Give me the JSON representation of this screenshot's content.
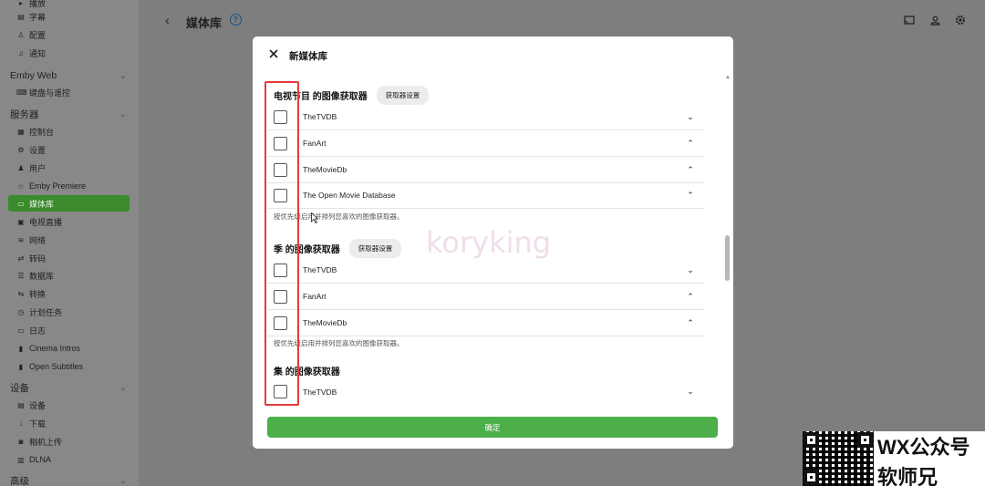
{
  "sidebar": {
    "items_top": [
      {
        "label": "播放",
        "icon": "play-icon"
      },
      {
        "label": "字幕",
        "icon": "subtitles-icon"
      },
      {
        "label": "配置",
        "icon": "profile-icon"
      },
      {
        "label": "通知",
        "icon": "bell-icon"
      }
    ],
    "emby_web_header": "Emby Web",
    "emby_web_items": [
      {
        "label": "键盘与遥控",
        "icon": "keyboard-icon"
      }
    ],
    "server_header": "服务器",
    "server_items": [
      {
        "label": "控制台",
        "icon": "dashboard-icon"
      },
      {
        "label": "设置",
        "icon": "gear-icon"
      },
      {
        "label": "用户",
        "icon": "users-icon"
      },
      {
        "label": "Emby Premiere",
        "icon": "star-icon"
      },
      {
        "label": "媒体库",
        "icon": "folder-icon"
      },
      {
        "label": "电视直播",
        "icon": "tv-icon"
      },
      {
        "label": "网络",
        "icon": "wifi-icon"
      },
      {
        "label": "转码",
        "icon": "transcode-icon"
      },
      {
        "label": "数据库",
        "icon": "database-icon"
      },
      {
        "label": "转换",
        "icon": "convert-icon"
      },
      {
        "label": "计划任务",
        "icon": "clock-icon"
      },
      {
        "label": "日志",
        "icon": "log-folder-icon"
      },
      {
        "label": "Cinema Intros",
        "icon": "film-icon"
      },
      {
        "label": "Open Subtitles",
        "icon": "film-icon"
      }
    ],
    "devices_header": "设备",
    "devices_items": [
      {
        "label": "设备",
        "icon": "devices-icon"
      },
      {
        "label": "下载",
        "icon": "download-icon"
      },
      {
        "label": "相机上传",
        "icon": "camera-icon"
      },
      {
        "label": "DLNA",
        "icon": "dlna-icon"
      }
    ],
    "advanced_header": "高级"
  },
  "header": {
    "back_glyph": "‹",
    "title": "媒体库",
    "help_glyph": "?"
  },
  "modal": {
    "title": "新媒体库",
    "tv_section": {
      "title": "电视节目 的图像获取器",
      "settings_button": "获取器设置",
      "rows": [
        {
          "label": "TheTVDB",
          "chevron": "down"
        },
        {
          "label": "FanArt",
          "chevron": "up"
        },
        {
          "label": "TheMovieDb",
          "chevron": "up"
        },
        {
          "label": "The Open Movie Database",
          "chevron": "up"
        }
      ],
      "hint": "按优先级启用并排列您喜欢的图像获取器。"
    },
    "season_section": {
      "title": "季 的图像获取器",
      "settings_button": "获取器设置",
      "rows": [
        {
          "label": "TheTVDB",
          "chevron": "down"
        },
        {
          "label": "FanArt",
          "chevron": "up"
        },
        {
          "label": "TheMovieDb",
          "chevron": "up"
        }
      ],
      "hint": "按优先级启用并排列您喜欢的图像获取器。"
    },
    "episode_section": {
      "title": "集 的图像获取器",
      "rows": [
        {
          "label": "TheTVDB",
          "chevron": "down"
        }
      ]
    },
    "confirm_button": "确定"
  },
  "watermark": "koryking",
  "badge": {
    "line1": "WX公众号",
    "line2": "软师兄"
  },
  "colors": {
    "accent_green": "#4caf4a",
    "sidebar_active": "#3b8a2b",
    "highlight_red": "#e53b3b"
  }
}
